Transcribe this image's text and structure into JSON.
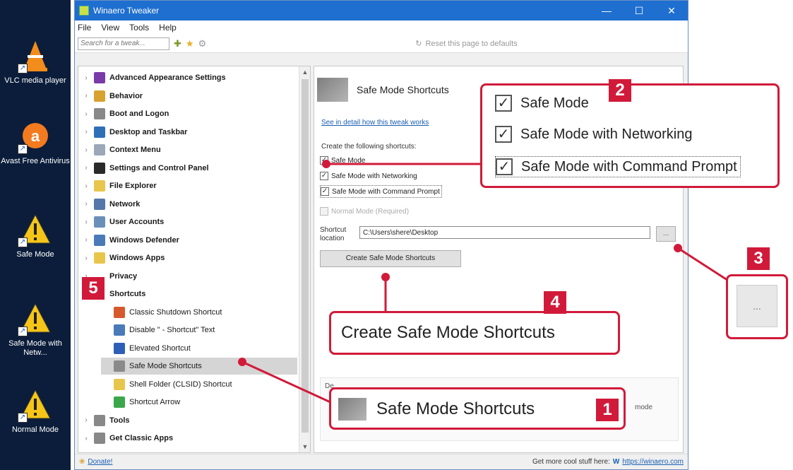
{
  "desktop": {
    "icons": [
      {
        "label": "VLC media player",
        "icon": "vlc-cone-icon"
      },
      {
        "label": "Avast Free Antivirus",
        "icon": "avast-icon"
      },
      {
        "label": "Safe Mode",
        "icon": "warning-icon"
      },
      {
        "label": "Safe Mode with Netw...",
        "icon": "warning-icon"
      },
      {
        "label": "Normal Mode",
        "icon": "warning-icon"
      }
    ]
  },
  "window": {
    "title": "Winaero Tweaker",
    "menu": [
      "File",
      "View",
      "Tools",
      "Help"
    ],
    "search_placeholder": "Search for a tweak...",
    "reset_label": "Reset this page to defaults"
  },
  "tree": {
    "items": [
      {
        "label": "Advanced Appearance Settings",
        "color": "#7a3aa8"
      },
      {
        "label": "Behavior",
        "color": "#d8a230"
      },
      {
        "label": "Boot and Logon",
        "color": "#888888"
      },
      {
        "label": "Desktop and Taskbar",
        "color": "#2e6fb8"
      },
      {
        "label": "Context Menu",
        "color": "#9aa8b8"
      },
      {
        "label": "Settings and Control Panel",
        "color": "#2a2a2a"
      },
      {
        "label": "File Explorer",
        "color": "#e8c64c"
      },
      {
        "label": "Network",
        "color": "#5577aa"
      },
      {
        "label": "User Accounts",
        "color": "#6a8fb8"
      },
      {
        "label": "Windows Defender",
        "color": "#4a7ab8"
      },
      {
        "label": "Windows Apps",
        "color": "#e8c64c"
      },
      {
        "label": "Privacy",
        "color": "#ffffff"
      },
      {
        "label": "Shortcuts",
        "color": "#ffffff"
      }
    ],
    "children": [
      {
        "label": "Classic Shutdown Shortcut",
        "color": "#d8582e"
      },
      {
        "label": "Disable \" - Shortcut\" Text",
        "color": "#4a7ab8"
      },
      {
        "label": "Elevated Shortcut",
        "color": "#2e5fb8"
      },
      {
        "label": "Safe Mode Shortcuts",
        "color": "#8a8a8a"
      },
      {
        "label": "Shell Folder (CLSID) Shortcut",
        "color": "#e8c64c"
      },
      {
        "label": "Shortcut Arrow",
        "color": "#3aa84a"
      }
    ],
    "tail": [
      {
        "label": "Tools",
        "color": "#888888"
      },
      {
        "label": "Get Classic Apps",
        "color": "#888888"
      }
    ]
  },
  "content": {
    "title": "Safe Mode Shortcuts",
    "detail_link": "See in detail how this tweak works",
    "create_label": "Create the following shortcuts:",
    "checkboxes": [
      {
        "label": "Safe Mode",
        "checked": true
      },
      {
        "label": "Safe Mode with Networking",
        "checked": true
      },
      {
        "label": "Safe Mode with Command Prompt",
        "checked": true
      },
      {
        "label": "Normal Mode (Required)",
        "checked": false
      }
    ],
    "shortcut_location_label": "Shortcut location",
    "shortcut_path": "C:\\Users\\shere\\Desktop",
    "browse_label": "...",
    "create_button": "Create Safe Mode Shortcuts",
    "desc_left": "De",
    "desc_right": "mode"
  },
  "statusbar": {
    "donate": "Donate!",
    "more": "Get more cool stuff here:",
    "link": "https://winaero.com"
  },
  "callouts": {
    "c1": {
      "num": "1",
      "text": "Safe Mode Shortcuts"
    },
    "c2": {
      "num": "2",
      "items": [
        "Safe Mode",
        "Safe Mode with Networking",
        "Safe Mode with Command Prompt"
      ]
    },
    "c3": {
      "num": "3",
      "text": "..."
    },
    "c4": {
      "num": "4",
      "text": "Create Safe Mode Shortcuts"
    },
    "c5": {
      "num": "5"
    }
  },
  "colors": {
    "accent": "#d11a3a",
    "titlebar": "#1e6fd0",
    "link": "#1a5fb4"
  }
}
